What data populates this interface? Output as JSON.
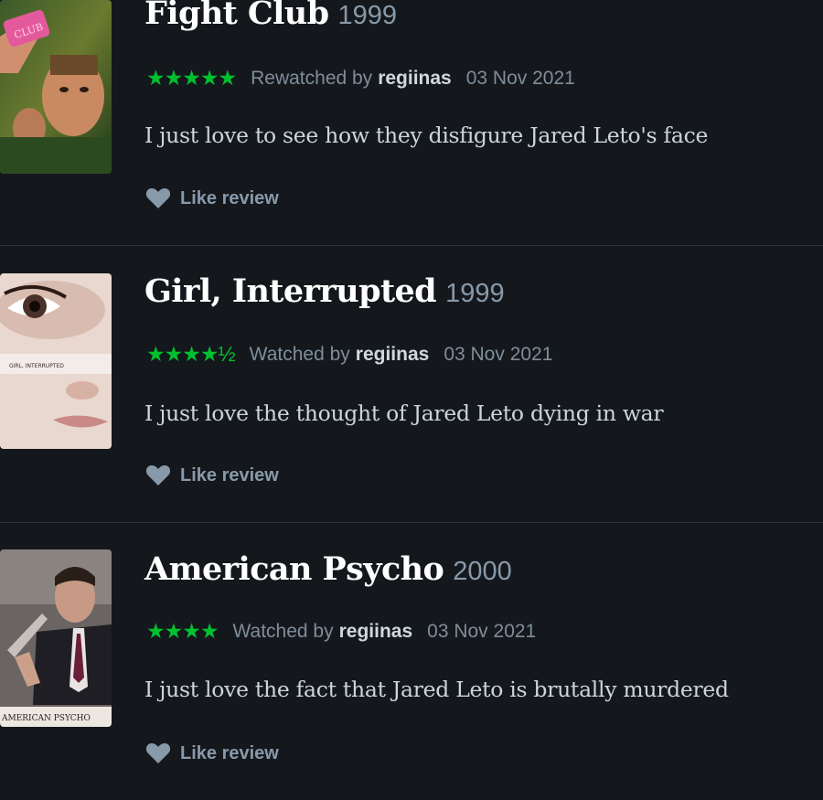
{
  "reviews": [
    {
      "title": "Fight Club",
      "year": "1999",
      "stars": "★★★★★",
      "status": "Rewatched by",
      "user": "regiinas",
      "date": "03 Nov 2021",
      "text": "I just love to see how they disfigure Jared Leto's face",
      "like_label": "Like review",
      "poster_text": "CLUB"
    },
    {
      "title": "Girl, Interrupted",
      "year": "1999",
      "stars": "★★★★½",
      "status": "Watched by",
      "user": "regiinas",
      "date": "03 Nov 2021",
      "text": "I just love the thought of Jared Leto dying in war",
      "like_label": "Like review",
      "poster_text": "GIRL, INTERRUPTED"
    },
    {
      "title": "American Psycho",
      "year": "2000",
      "stars": "★★★★",
      "status": "Watched by",
      "user": "regiinas",
      "date": "03 Nov 2021",
      "text": "I just love the fact that Jared Leto is brutally murdered",
      "like_label": "Like review",
      "poster_text": "AMERICAN PSYCHO"
    }
  ],
  "colors": {
    "background": "#14181c",
    "star": "#00c030",
    "title": "#ffffff",
    "muted": "#8899aa"
  },
  "icons": {
    "like": "heart-icon"
  }
}
